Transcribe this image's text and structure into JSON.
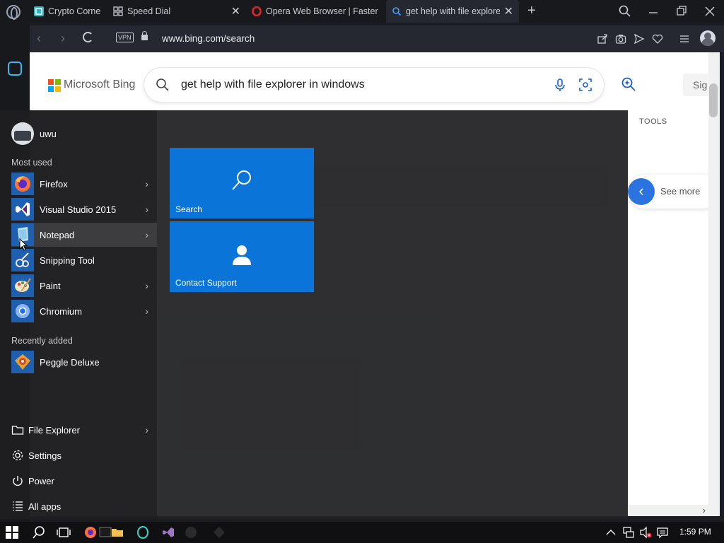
{
  "browser": {
    "tabs": [
      {
        "title": "Crypto Corner",
        "favicon": "crypto-favicon-icon"
      },
      {
        "title": "Speed Dial",
        "favicon": "speed-dial-icon"
      },
      {
        "title": "Opera Web Browser | Faster",
        "favicon": "opera-favicon-icon"
      },
      {
        "title": "get help with file explorer",
        "favicon": "bing-search-favicon-icon",
        "active": true
      }
    ],
    "url": "www.bing.com/search",
    "vpn_label": "VPN"
  },
  "bing": {
    "brand": "Microsoft Bing",
    "query": "get help with file explorer in windows",
    "sign_in": "Sig",
    "tools": "TOOLS",
    "see_more": "See more"
  },
  "start_menu": {
    "user": "uwu",
    "most_used_label": "Most used",
    "most_used": [
      {
        "label": "Firefox",
        "icon": "firefox-icon",
        "has_submenu": true
      },
      {
        "label": "Visual Studio 2015",
        "icon": "visual-studio-icon",
        "has_submenu": true
      },
      {
        "label": "Notepad",
        "icon": "notepad-icon",
        "has_submenu": true,
        "hover": true
      },
      {
        "label": "Snipping Tool",
        "icon": "snipping-tool-icon",
        "has_submenu": false
      },
      {
        "label": "Paint",
        "icon": "paint-icon",
        "has_submenu": true
      },
      {
        "label": "Chromium",
        "icon": "chromium-icon",
        "has_submenu": true
      }
    ],
    "recently_added_label": "Recently added",
    "recently_added": [
      {
        "label": "Peggle Deluxe",
        "icon": "peggle-icon"
      }
    ],
    "system": [
      {
        "label": "File Explorer",
        "icon": "folder-icon",
        "has_submenu": true
      },
      {
        "label": "Settings",
        "icon": "gear-icon"
      },
      {
        "label": "Power",
        "icon": "power-icon"
      },
      {
        "label": "All apps",
        "icon": "list-icon"
      }
    ],
    "tiles": [
      {
        "label": "Search",
        "icon": "search-icon"
      },
      {
        "label": "Contact Support",
        "icon": "support-agent-icon"
      }
    ]
  },
  "taskbar": {
    "time": "1:59 PM"
  }
}
